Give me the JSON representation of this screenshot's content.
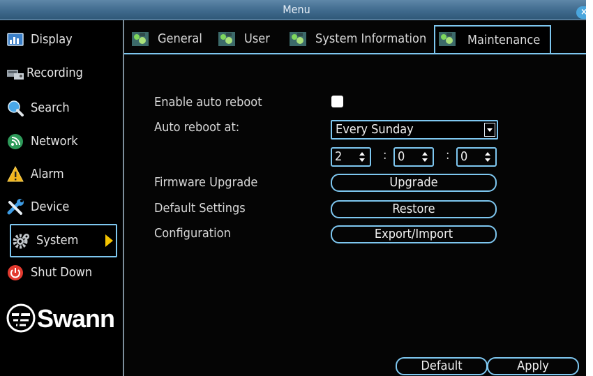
{
  "window": {
    "title": "Menu",
    "close_glyph": "×"
  },
  "sidebar": {
    "items": [
      {
        "label": "Display",
        "icon": "display-icon"
      },
      {
        "label": "Recording",
        "icon": "recording-icon"
      },
      {
        "label": "Search",
        "icon": "search-icon"
      },
      {
        "label": "Network",
        "icon": "network-icon"
      },
      {
        "label": "Alarm",
        "icon": "alarm-icon"
      },
      {
        "label": "Device",
        "icon": "device-icon"
      },
      {
        "label": "System",
        "icon": "gear-icon",
        "active": true
      },
      {
        "label": "Shut Down",
        "icon": "power-icon"
      }
    ],
    "logo_text": "Swann"
  },
  "tabs": [
    {
      "label": "General"
    },
    {
      "label": "User"
    },
    {
      "label": "System Information"
    },
    {
      "label": "Maintenance",
      "active": true
    }
  ],
  "form": {
    "auto_reboot_label": "Enable auto reboot",
    "auto_reboot_checked": false,
    "reboot_at_label": "Auto reboot at:",
    "reboot_at_value": "Every Sunday",
    "time": {
      "hour": "2",
      "minute": "0",
      "second": "0",
      "separator": ":"
    },
    "firmware_label": "Firmware Upgrade",
    "upgrade_button": "Upgrade",
    "default_settings_label": "Default Settings",
    "restore_button": "Restore",
    "configuration_label": "Configuration",
    "export_import_button": "Export/Import"
  },
  "footer": {
    "default_button": "Default",
    "apply_button": "Apply"
  },
  "colors": {
    "accent": "#7ec7f0",
    "titlebar": "#4a7598",
    "background": "#050505",
    "arrow": "#f5c400"
  }
}
